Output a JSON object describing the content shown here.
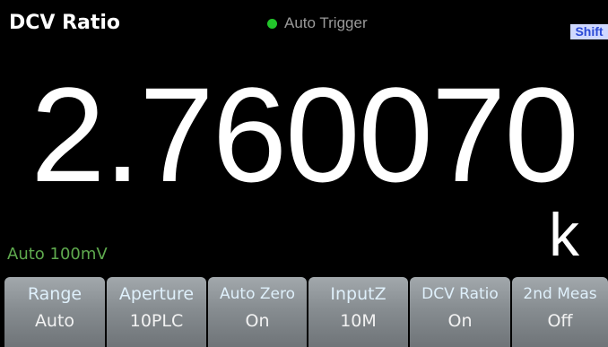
{
  "header": {
    "title": "DCV Ratio",
    "trigger_status": "Auto Trigger",
    "trigger_indicator_color": "#22c52b",
    "shift_label": "Shift"
  },
  "display": {
    "reading": "2.760070",
    "unit": "k",
    "range_info": "Auto 100mV"
  },
  "softkeys": [
    {
      "label": "Range",
      "value": "Auto"
    },
    {
      "label": "Aperture",
      "value": "10PLC"
    },
    {
      "label": "Auto Zero",
      "value": "On"
    },
    {
      "label": "InputZ",
      "value": "10M"
    },
    {
      "label": "DCV Ratio",
      "value": "On"
    },
    {
      "label": "2nd Meas",
      "value": "Off"
    }
  ]
}
